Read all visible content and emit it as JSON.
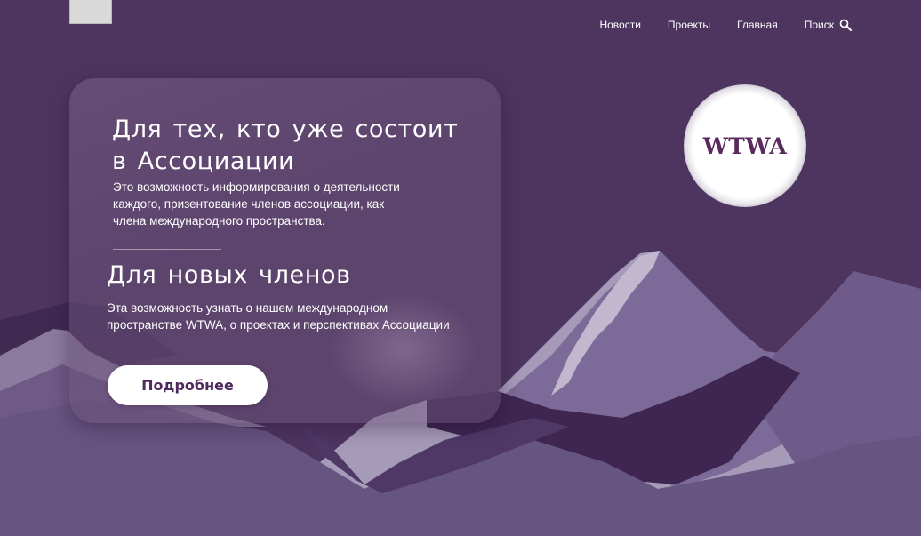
{
  "nav": {
    "items": [
      {
        "label": "Новости"
      },
      {
        "label": "Проекты"
      },
      {
        "label": "Главная"
      }
    ],
    "search_label": "Поиск"
  },
  "logo": {
    "text": "WTWA"
  },
  "members": {
    "heading_line1": "Для тех, кто уже состоит",
    "heading_line2": "в Ассоциации",
    "text_line1": "Это возможность информирования о  деятельности",
    "text_line2": "каждого, призентование членов ассоциации, как",
    "text_line3": "члена международного пространства."
  },
  "new_members": {
    "heading": "Для новых членов",
    "text_line1": "Эта возможность узнать о нашем международном",
    "text_line2": "пространстве WTWA, о проектах и перспективах Ассоциации"
  },
  "cta": {
    "label": "Подробнее"
  },
  "colors": {
    "background": "#4e3560",
    "button_text": "#4e2a5e",
    "logo_text": "#5a2a5e"
  }
}
